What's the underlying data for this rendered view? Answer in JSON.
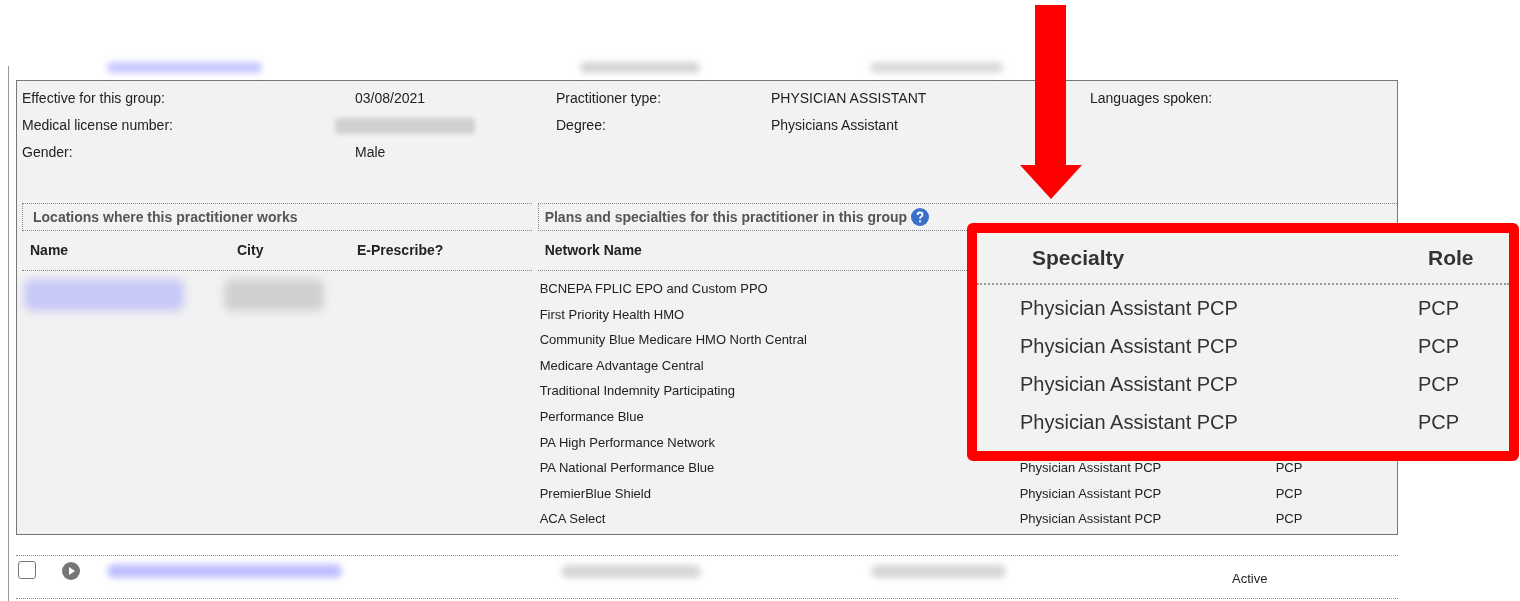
{
  "details": [
    {
      "kind": "text",
      "label": "Effective for this group:",
      "value": "03/08/2021"
    },
    {
      "kind": "text",
      "label": "Practitioner type:",
      "value": "PHYSICIAN ASSISTANT"
    },
    {
      "kind": "text",
      "label": "Languages spoken:"
    },
    {
      "kind": "redacted",
      "label": "Medical license number:"
    },
    {
      "kind": "text",
      "label": "Degree:",
      "value": "Physicians Assistant"
    },
    {
      "kind": "text",
      "label": "Gender:",
      "value": "Male"
    }
  ],
  "locations": {
    "title": "Locations where this practitioner works",
    "columns": [
      "Name",
      "City",
      "E-Prescribe?"
    ]
  },
  "plans": {
    "title": "Plans and specialties for this practitioner in this group",
    "columns": [
      "Network Name"
    ],
    "rows": [
      {
        "network": "BCNEPA FPLIC EPO and Custom PPO"
      },
      {
        "network": "First Priority Health HMO"
      },
      {
        "network": "Community Blue Medicare HMO North Central"
      },
      {
        "network": "Medicare Advantage Central"
      },
      {
        "network": "Traditional Indemnity Participating"
      },
      {
        "network": "Performance Blue"
      },
      {
        "network": "PA High Performance Network"
      },
      {
        "network": "PA National Performance Blue",
        "specialty": "Physician Assistant PCP",
        "role": "PCP"
      },
      {
        "network": "PremierBlue Shield",
        "specialty": "Physician Assistant PCP",
        "role": "PCP"
      },
      {
        "network": "ACA Select",
        "specialty": "Physician Assistant PCP",
        "role": "PCP"
      }
    ]
  },
  "callout": {
    "columns": [
      "Specialty",
      "Role"
    ],
    "rows": [
      {
        "specialty": "Physician Assistant PCP",
        "role": "PCP"
      },
      {
        "specialty": "Physician Assistant PCP",
        "role": "PCP"
      },
      {
        "specialty": "Physician Assistant PCP",
        "role": "PCP"
      },
      {
        "specialty": "Physician Assistant PCP",
        "role": "PCP"
      }
    ]
  },
  "next_row": {
    "checked": false,
    "status": "Active"
  }
}
